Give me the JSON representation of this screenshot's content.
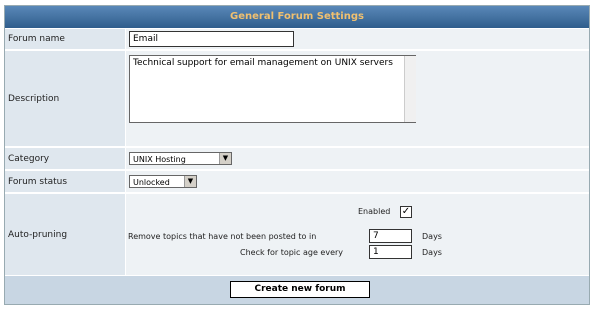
{
  "header": {
    "title": "General Forum Settings"
  },
  "forum_name": {
    "label": "Forum name",
    "value": "Email"
  },
  "description": {
    "label": "Description",
    "value": "Technical support for email management on UNIX servers"
  },
  "category": {
    "label": "Category",
    "selected": "UNIX Hosting"
  },
  "forum_status": {
    "label": "Forum status",
    "selected": "Unlocked"
  },
  "auto_pruning": {
    "label": "Auto-pruning",
    "enabled_label": "Enabled",
    "enabled_check": "✓",
    "remove_label": "Remove topics that have not been posted to in",
    "remove_value": "7",
    "remove_unit": "Days",
    "check_label": "Check for topic age every",
    "check_value": "1",
    "check_unit": "Days"
  },
  "footer": {
    "submit_label": "Create new forum"
  }
}
